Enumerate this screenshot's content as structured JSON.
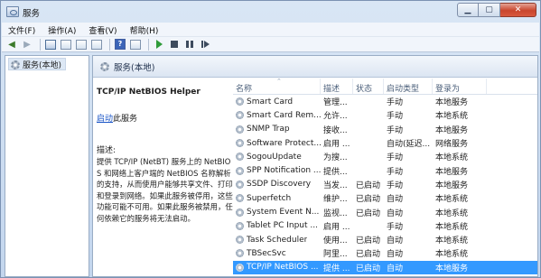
{
  "window": {
    "title": "服务"
  },
  "caption": {
    "minimize": "▁",
    "maximize": "▢",
    "close": "✕"
  },
  "menu": [
    "文件(F)",
    "操作(A)",
    "查看(V)",
    "帮助(H)"
  ],
  "toolbar": {
    "icons": [
      "back-arrow-icon",
      "forward-arrow-icon",
      "show-hide-tree-icon",
      "properties-icon",
      "refresh-icon",
      "export-list-icon",
      "help-icon",
      "console-icon",
      "start-service-icon",
      "stop-service-icon",
      "pause-service-icon",
      "restart-service-icon"
    ]
  },
  "tree": {
    "root_label": "服务(本地)"
  },
  "right_header": {
    "title": "服务(本地)"
  },
  "detail": {
    "service_name": "TCP/IP NetBIOS Helper",
    "start_link": "启动",
    "start_suffix": "此服务",
    "description_label": "描述:",
    "description_text": "提供 TCP/IP (NetBT) 服务上的 NetBIOS 和网络上客户端的 NetBIOS 名称解析的支持，从而使用户能够共享文件、打印和登录到网络。如果此服务被停用，这些功能可能不可用。如果此服务被禁用，任何依赖它的服务将无法启动。"
  },
  "columns": {
    "name": "名称",
    "desc": "描述",
    "status": "状态",
    "startup": "启动类型",
    "login": "登录为"
  },
  "services": [
    {
      "name": "Smart Card",
      "desc": "管理...",
      "status": "",
      "startup": "手动",
      "login": "本地服务"
    },
    {
      "name": "Smart Card Rem...",
      "desc": "允许...",
      "status": "",
      "startup": "手动",
      "login": "本地系统"
    },
    {
      "name": "SNMP Trap",
      "desc": "接收...",
      "status": "",
      "startup": "手动",
      "login": "本地服务"
    },
    {
      "name": "Software Protect...",
      "desc": "启用 ...",
      "status": "",
      "startup": "自动(延迟...",
      "login": "网络服务"
    },
    {
      "name": "SogouUpdate",
      "desc": "为搜...",
      "status": "",
      "startup": "手动",
      "login": "本地系统"
    },
    {
      "name": "SPP Notification ...",
      "desc": "提供...",
      "status": "",
      "startup": "手动",
      "login": "本地服务"
    },
    {
      "name": "SSDP Discovery",
      "desc": "当发...",
      "status": "已启动",
      "startup": "手动",
      "login": "本地服务"
    },
    {
      "name": "Superfetch",
      "desc": "维护...",
      "status": "已启动",
      "startup": "自动",
      "login": "本地系统"
    },
    {
      "name": "System Event N...",
      "desc": "监视...",
      "status": "已启动",
      "startup": "自动",
      "login": "本地系统"
    },
    {
      "name": "Tablet PC Input ...",
      "desc": "启用 ...",
      "status": "",
      "startup": "手动",
      "login": "本地系统"
    },
    {
      "name": "Task Scheduler",
      "desc": "使用...",
      "status": "已启动",
      "startup": "自动",
      "login": "本地系统"
    },
    {
      "name": "TBSecSvc",
      "desc": "阿里...",
      "status": "已启动",
      "startup": "自动",
      "login": "本地系统"
    },
    {
      "name": "TCP/IP NetBIOS ...",
      "desc": "提供 ...",
      "status": "已启动",
      "startup": "自动",
      "login": "本地服务",
      "selected": true
    }
  ]
}
